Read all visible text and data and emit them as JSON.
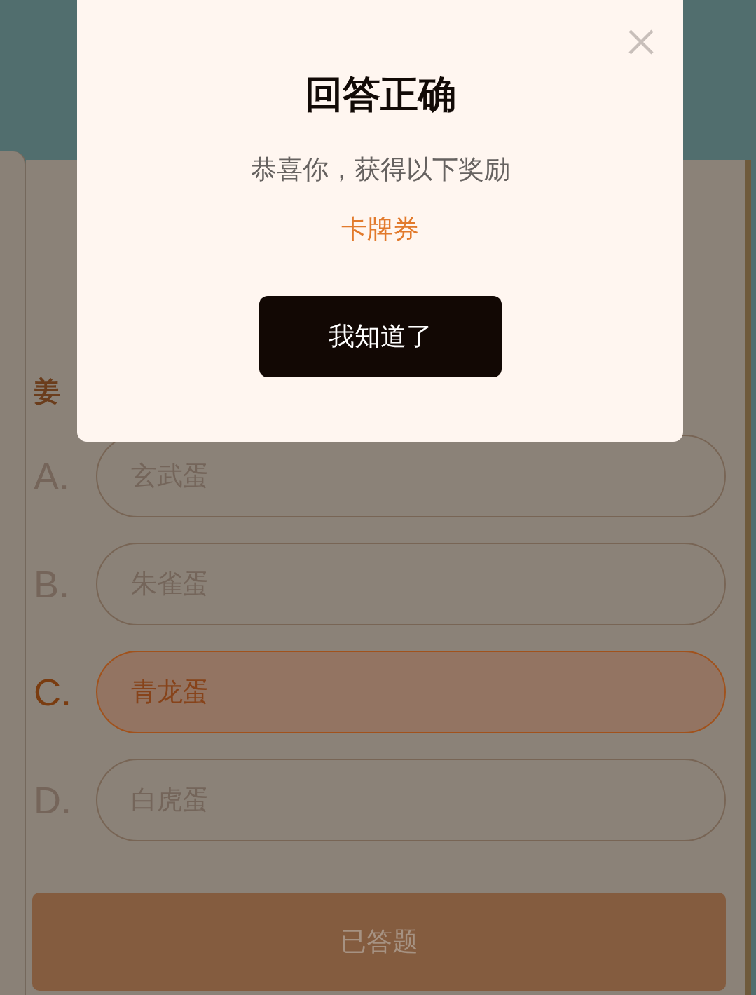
{
  "page": {
    "question": "姜",
    "options": [
      {
        "letter": "A.",
        "text": "玄武蛋",
        "selected": false
      },
      {
        "letter": "B.",
        "text": "朱雀蛋",
        "selected": false
      },
      {
        "letter": "C.",
        "text": "青龙蛋",
        "selected": true
      },
      {
        "letter": "D.",
        "text": "白虎蛋",
        "selected": false
      }
    ],
    "submit_button": {
      "label": "已答题",
      "disabled": true
    }
  },
  "dialog": {
    "title": "回答正确",
    "message": "恭喜你，获得以下奖励",
    "reward": "卡牌券",
    "button": "我知道了"
  }
}
